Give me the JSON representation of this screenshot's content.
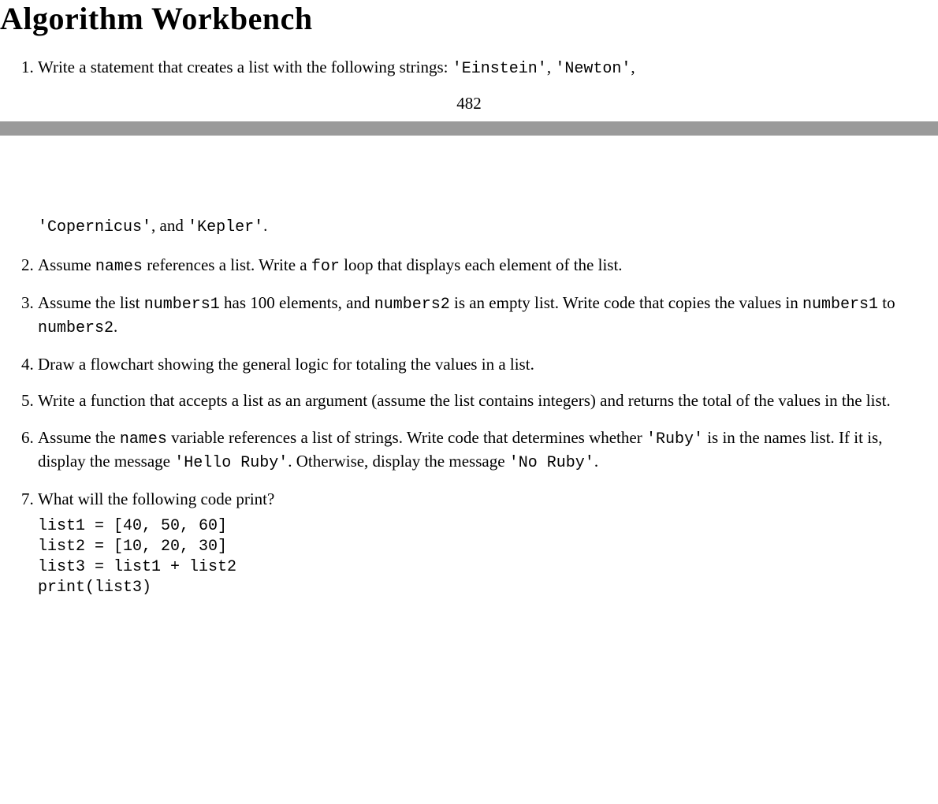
{
  "title": "Algorithm Workbench",
  "page_number": "482",
  "q1": {
    "num": "1.",
    "text_a": "Write a statement that creates a list with the following strings: ",
    "code_a": "'Einstein'",
    "sep_a": ", ",
    "code_b": "'Newton'",
    "sep_b": ",",
    "cont_code_a": "'Copernicus'",
    "cont_text_a": ", and ",
    "cont_code_b": "'Kepler'",
    "cont_text_b": "."
  },
  "q2": {
    "text_a": "Assume ",
    "code_a": "names",
    "text_b": " references a list. Write a ",
    "code_b": "for",
    "text_c": " loop that displays each element of the list."
  },
  "q3": {
    "text_a": "Assume the list ",
    "code_a": "numbers1",
    "text_b": " has 100 elements, and ",
    "code_b": "numbers2",
    "text_c": " is an empty list. Write code that copies the values in ",
    "code_c": "numbers1",
    "text_d": " to ",
    "code_d": "numbers2",
    "text_e": "."
  },
  "q4": {
    "text": "Draw a flowchart showing the general logic for totaling the values in a list."
  },
  "q5": {
    "text": "Write a function that accepts a list as an argument (assume the list contains integers) and returns the total of the values in the list."
  },
  "q6": {
    "text_a": "Assume the ",
    "code_a": "names",
    "text_b": " variable references a list of strings. Write code that determines whether ",
    "code_b": "'Ruby'",
    "text_c": " is in the names list. If it is, display the message ",
    "code_c": "'Hello Ruby'",
    "text_d": ". Otherwise, display the message ",
    "code_d": "'No Ruby'",
    "text_e": "."
  },
  "q7": {
    "text": "What will the following code print?",
    "code": "list1 = [40, 50, 60]\nlist2 = [10, 20, 30]\nlist3 = list1 + list2\nprint(list3)"
  }
}
